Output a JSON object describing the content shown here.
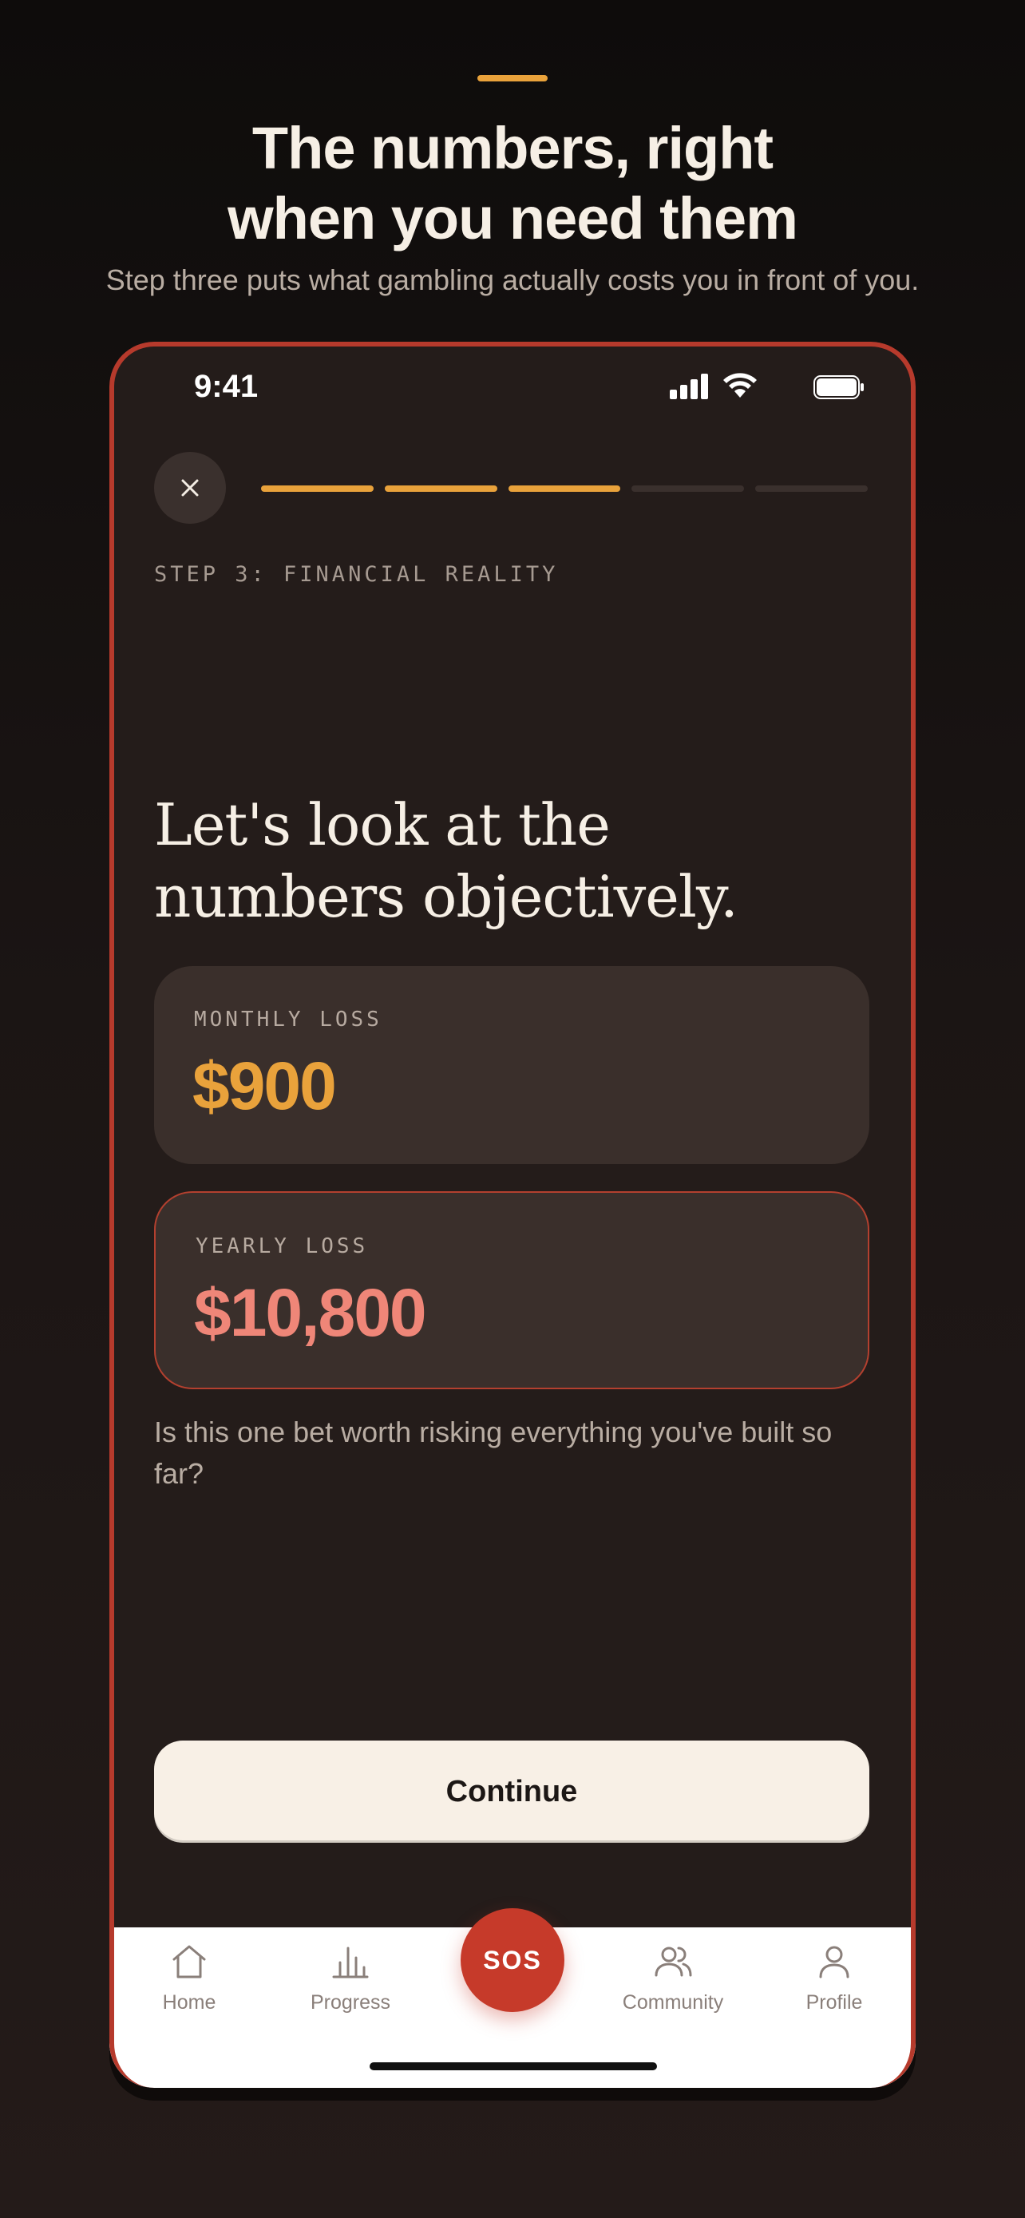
{
  "promo": {
    "headline_line1": "The numbers, right",
    "headline_line2": "when you need them",
    "subhead": "Step three puts what gambling actually costs you in front of you."
  },
  "status_bar": {
    "time": "9:41",
    "icons": [
      "signal-icon",
      "wifi-icon",
      "battery-icon"
    ]
  },
  "header": {
    "close_icon": "close-icon",
    "progress": {
      "total_steps": 5,
      "completed_steps": 3
    }
  },
  "step": {
    "label": "STEP 3: FINANCIAL REALITY",
    "title_line1": "Let's look at the",
    "title_line2": "numbers objectively."
  },
  "cards": {
    "monthly": {
      "label": "MONTHLY LOSS",
      "value": "$900"
    },
    "yearly": {
      "label": "YEARLY LOSS",
      "value": "$10,800"
    }
  },
  "question": "Is this one bet worth risking everything you've built so far?",
  "continue_label": "Continue",
  "tabbar": {
    "home": "Home",
    "progress": "Progress",
    "sos": "SOS",
    "community": "Community",
    "profile": "Profile"
  },
  "colors": {
    "accent": "#e9a23b",
    "danger": "#ef8678",
    "sos": "#c63a2a",
    "frame_border": "#b63a2c"
  }
}
